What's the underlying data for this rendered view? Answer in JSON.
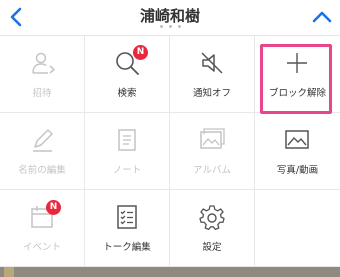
{
  "header": {
    "title": "浦崎和樹"
  },
  "menu": [
    {
      "label": "招待",
      "icon": "add-friend-icon",
      "enabled": false
    },
    {
      "label": "検索",
      "icon": "search-icon",
      "enabled": true,
      "badge": "N"
    },
    {
      "label": "通知オフ",
      "icon": "mute-icon",
      "enabled": true
    },
    {
      "label": "ブロック解除",
      "icon": "plus-icon",
      "enabled": true,
      "highlighted": true
    },
    {
      "label": "名前の編集",
      "icon": "pencil-icon",
      "enabled": false
    },
    {
      "label": "ノート",
      "icon": "note-icon",
      "enabled": false
    },
    {
      "label": "アルバム",
      "icon": "album-icon",
      "enabled": false
    },
    {
      "label": "写真/動画",
      "icon": "photo-icon",
      "enabled": true
    },
    {
      "label": "イベント",
      "icon": "calendar-icon",
      "enabled": false,
      "badge": "N"
    },
    {
      "label": "トーク編集",
      "icon": "checklist-icon",
      "enabled": true
    },
    {
      "label": "設定",
      "icon": "gear-icon",
      "enabled": true
    }
  ],
  "colors": {
    "accent": "#1a73e8",
    "badge": "#e8283c",
    "highlight": "#e8468a",
    "disabled": "#c4c4c4"
  }
}
